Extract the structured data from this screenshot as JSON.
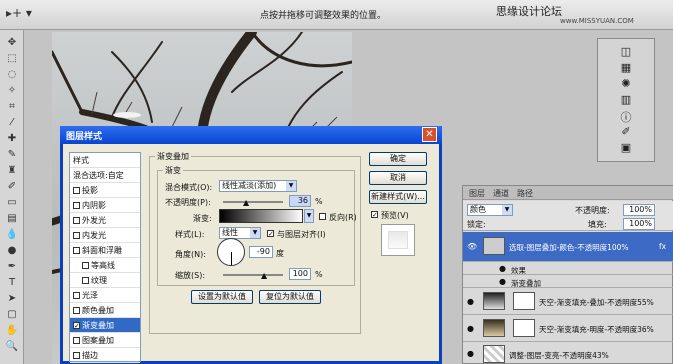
{
  "options_bar": {
    "tool_glyph": "▸+ ▾",
    "hint": "点按并拖移可调整效果的位置。",
    "watermark": "思缘设计论坛",
    "watermark_url": "www.MISSYUAN.COM"
  },
  "dialog": {
    "title": "图层样式",
    "sidebar": {
      "styles_label": "样式",
      "blend_label": "混合选项:自定",
      "items": [
        {
          "label": "投影",
          "checked": false
        },
        {
          "label": "内阴影",
          "checked": false
        },
        {
          "label": "外发光",
          "checked": false
        },
        {
          "label": "内发光",
          "checked": false
        },
        {
          "label": "斜面和浮雕",
          "checked": false
        },
        {
          "label": "等高线",
          "checked": false
        },
        {
          "label": "纹理",
          "checked": false
        },
        {
          "label": "光泽",
          "checked": false
        },
        {
          "label": "颜色叠加",
          "checked": false
        },
        {
          "label": "渐变叠加",
          "checked": true
        },
        {
          "label": "图案叠加",
          "checked": false
        },
        {
          "label": "描边",
          "checked": false
        }
      ]
    },
    "section_title": "渐变叠加",
    "group_title": "渐变",
    "blend_mode_label": "混合模式(O):",
    "blend_mode_value": "线性减淡(添加)",
    "opacity_label": "不透明度(P):",
    "opacity_value": "36",
    "percent": "%",
    "gradient_label": "渐变:",
    "reverse_label": "反向(R)",
    "style_label": "样式(L):",
    "style_value": "线性",
    "align_label": "与图层对齐(I)",
    "angle_label": "角度(N):",
    "angle_value": "-90",
    "degree": "度",
    "scale_label": "缩放(S):",
    "scale_value": "100",
    "set_default": "设置为默认值",
    "reset_default": "复位为默认值",
    "ok": "确定",
    "cancel": "取消",
    "new_style": "新建样式(W)...",
    "preview": "预览(V)"
  },
  "layers_panel": {
    "tabs": [
      "图层",
      "通道",
      "路径"
    ],
    "blend_value": "颜色",
    "opacity_label": "不透明度:",
    "opacity_value": "100%",
    "fill_label": "填充:",
    "fill_value": "100%",
    "lock_label": "锁定:",
    "layers": [
      {
        "name": "选取-图层叠加-颜色-不透明度100%",
        "fx": "fx"
      },
      {
        "name": "效果",
        "fx": ""
      },
      {
        "name": "渐变叠加",
        "fx": ""
      },
      {
        "name": "天空-渐变填充-叠加-不透明度55%",
        "fx": ""
      },
      {
        "name": "天空-渐变填充-明度-不透明度36%",
        "fx": ""
      },
      {
        "name": "调整-图层-变亮-不透明度43%",
        "fx": ""
      }
    ]
  }
}
